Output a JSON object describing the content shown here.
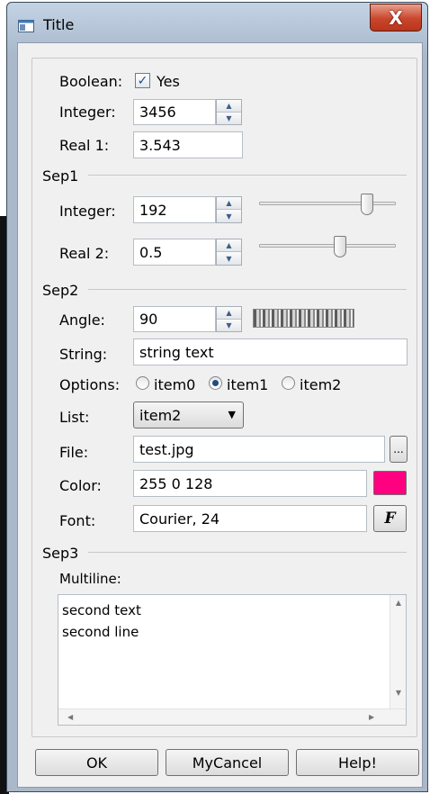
{
  "window": {
    "title": "Title",
    "close_glyph": "X"
  },
  "boolean": {
    "label": "Boolean:",
    "checked": true,
    "text": "Yes"
  },
  "integer1": {
    "label": "Integer:",
    "value": "3456"
  },
  "real1": {
    "label": "Real 1:",
    "value": "3.543"
  },
  "sep1": {
    "label": "Sep1"
  },
  "integer2": {
    "label": "Integer:",
    "value": "192",
    "slider_level": 0.82
  },
  "real2": {
    "label": "Real 2:",
    "value": "0.5",
    "slider_level": 0.6
  },
  "sep2": {
    "label": "Sep2"
  },
  "angle": {
    "label": "Angle:",
    "value": "90"
  },
  "string": {
    "label": "String:",
    "value": "string text"
  },
  "options": {
    "label": "Options:",
    "items": [
      "item0",
      "item1",
      "item2"
    ],
    "selected": "item1"
  },
  "list": {
    "label": "List:",
    "selected": "item2",
    "arrow_glyph": "▼"
  },
  "file": {
    "label": "File:",
    "value": "test.jpg",
    "browse_label": "..."
  },
  "color": {
    "label": "Color:",
    "value": "255 0 128",
    "swatch": "#ff0080"
  },
  "font": {
    "label": "Font:",
    "value": "Courier, 24",
    "button_glyph": "F"
  },
  "sep3": {
    "label": "Sep3"
  },
  "multiline": {
    "label": "Multiline:",
    "lines": [
      "second text",
      "second line"
    ]
  },
  "buttons": {
    "ok": "OK",
    "cancel": "MyCancel",
    "help": "Help!"
  },
  "icons": {
    "spin_up": "▲",
    "spin_down": "▼",
    "scroll_up": "▲",
    "scroll_down": "▼",
    "scroll_left": "◀",
    "scroll_right": "▶",
    "check": "✓"
  }
}
